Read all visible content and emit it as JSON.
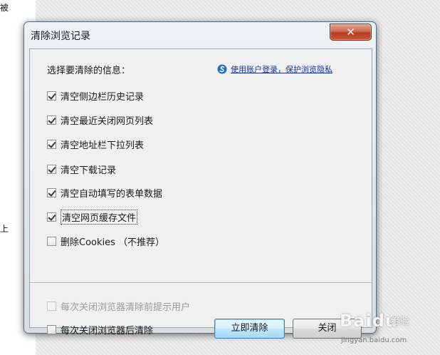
{
  "background": {
    "left_fragments": [
      "被",
      "上"
    ]
  },
  "dialog": {
    "title": "清除浏览记录",
    "prompt": "选择要清除的信息：",
    "login_link": "使用账户登录，保护浏览隐私",
    "options": [
      {
        "label": "清空侧边栏历史记录",
        "checked": true
      },
      {
        "label": "清空最近关闭网页列表",
        "checked": true
      },
      {
        "label": "清空地址栏下拉列表",
        "checked": true
      },
      {
        "label": "清空下载记录",
        "checked": true
      },
      {
        "label": "清空自动填写的表单数据",
        "checked": true
      },
      {
        "label": "清空网页缓存文件",
        "checked": true
      },
      {
        "label": "删除Cookies （不推荐）",
        "checked": false
      }
    ],
    "bottom_options": [
      {
        "label": "每次关闭浏览器清除前提示用户",
        "checked": false,
        "enabled": false
      },
      {
        "label": "每次关闭浏览器后清除",
        "checked": false,
        "enabled": true
      }
    ],
    "buttons": {
      "clear_now": "立即清除",
      "close": "关闭"
    }
  },
  "watermark": {
    "brand": "Baidu",
    "experience": "经验",
    "url": "jingyan.baidu.com"
  },
  "colors": {
    "link": "#1a33a6",
    "close_button": "#c8563a",
    "default_button_border": "#3c7fb1"
  }
}
